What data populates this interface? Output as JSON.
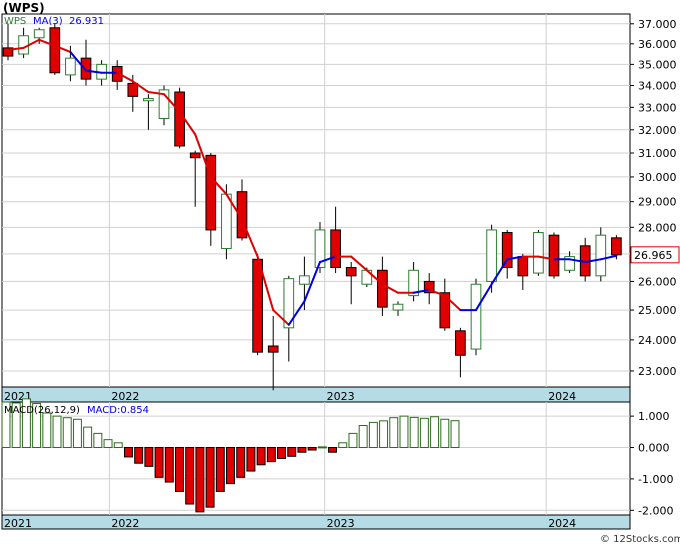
{
  "title": "(WPS)",
  "footer": "© 12Stocks.com",
  "colors": {
    "up": "#2e7d32",
    "down": "#e00000",
    "ma_down": "#e00000",
    "ma_up": "#0000e0",
    "macd_pos": "#2e6b1e",
    "macd_neg": "#e00000",
    "axis_band": "#b5dce6",
    "grid": "#d0d0d0",
    "last_box": "#e00000"
  },
  "chart_data": [
    {
      "type": "candlestick",
      "legend": {
        "symbol": "WPS",
        "ma_label": "MA(3)",
        "ma_value": "26.931"
      },
      "last_price_label": "26.965",
      "y_scale": "log",
      "ylim": [
        22.5,
        37.5
      ],
      "y_ticks": [
        "37.000",
        "36.000",
        "35.000",
        "34.000",
        "33.000",
        "32.000",
        "31.000",
        "30.000",
        "29.000",
        "28.000",
        "27.000",
        "26.000",
        "25.000",
        "24.000",
        "23.000"
      ],
      "x_labels": [
        "2021",
        "2022",
        "2023",
        "2024"
      ],
      "x_label_index": [
        0,
        6.5,
        20.3,
        34.5
      ],
      "grid": true,
      "candles": [
        {
          "o": 35.8,
          "h": 37.0,
          "l": 35.2,
          "c": 35.4
        },
        {
          "o": 35.5,
          "h": 36.8,
          "l": 35.3,
          "c": 36.4
        },
        {
          "o": 36.3,
          "h": 36.8,
          "l": 36.0,
          "c": 36.7
        },
        {
          "o": 36.8,
          "h": 37.0,
          "l": 34.5,
          "c": 34.6
        },
        {
          "o": 34.5,
          "h": 35.9,
          "l": 34.2,
          "c": 35.3
        },
        {
          "o": 35.3,
          "h": 36.2,
          "l": 34.0,
          "c": 34.3
        },
        {
          "o": 34.3,
          "h": 35.2,
          "l": 34.0,
          "c": 35.0
        },
        {
          "o": 34.9,
          "h": 35.2,
          "l": 33.8,
          "c": 34.2
        },
        {
          "o": 34.1,
          "h": 34.5,
          "l": 32.8,
          "c": 33.5
        },
        {
          "o": 33.3,
          "h": 33.6,
          "l": 32.0,
          "c": 33.4
        },
        {
          "o": 32.5,
          "h": 34.0,
          "l": 32.2,
          "c": 33.8
        },
        {
          "o": 33.7,
          "h": 33.9,
          "l": 31.2,
          "c": 31.3
        },
        {
          "o": 31.0,
          "h": 31.1,
          "l": 28.8,
          "c": 30.8
        },
        {
          "o": 30.9,
          "h": 31.0,
          "l": 27.3,
          "c": 27.9
        },
        {
          "o": 27.2,
          "h": 29.7,
          "l": 26.8,
          "c": 29.3
        },
        {
          "o": 29.4,
          "h": 29.9,
          "l": 27.5,
          "c": 27.6
        },
        {
          "o": 26.8,
          "h": 27.0,
          "l": 23.5,
          "c": 23.6
        },
        {
          "o": 23.8,
          "h": 24.8,
          "l": 22.4,
          "c": 23.6
        },
        {
          "o": 24.4,
          "h": 26.2,
          "l": 23.3,
          "c": 26.1
        },
        {
          "o": 25.9,
          "h": 26.9,
          "l": 25.0,
          "c": 26.2
        },
        {
          "o": 26.5,
          "h": 28.2,
          "l": 26.3,
          "c": 27.9
        },
        {
          "o": 27.9,
          "h": 28.8,
          "l": 26.3,
          "c": 26.5
        },
        {
          "o": 26.5,
          "h": 26.7,
          "l": 25.2,
          "c": 26.2
        },
        {
          "o": 25.9,
          "h": 26.5,
          "l": 25.8,
          "c": 26.4
        },
        {
          "o": 26.4,
          "h": 26.9,
          "l": 24.8,
          "c": 25.1
        },
        {
          "o": 25.0,
          "h": 25.3,
          "l": 24.8,
          "c": 25.2
        },
        {
          "o": 25.5,
          "h": 26.7,
          "l": 25.3,
          "c": 26.4
        },
        {
          "o": 26.0,
          "h": 26.3,
          "l": 25.2,
          "c": 25.6
        },
        {
          "o": 25.6,
          "h": 26.1,
          "l": 24.3,
          "c": 24.4
        },
        {
          "o": 24.3,
          "h": 24.4,
          "l": 22.8,
          "c": 23.5
        },
        {
          "o": 23.7,
          "h": 26.1,
          "l": 23.5,
          "c": 25.9
        },
        {
          "o": 26.0,
          "h": 28.1,
          "l": 25.6,
          "c": 27.9
        },
        {
          "o": 27.8,
          "h": 27.9,
          "l": 26.1,
          "c": 26.5
        },
        {
          "o": 26.9,
          "h": 27.0,
          "l": 25.7,
          "c": 26.2
        },
        {
          "o": 26.3,
          "h": 27.9,
          "l": 26.2,
          "c": 27.8
        },
        {
          "o": 27.7,
          "h": 27.8,
          "l": 26.1,
          "c": 26.2
        },
        {
          "o": 26.4,
          "h": 27.1,
          "l": 26.3,
          "c": 26.9
        },
        {
          "o": 27.3,
          "h": 27.6,
          "l": 26.0,
          "c": 26.2
        },
        {
          "o": 26.2,
          "h": 28.0,
          "l": 26.0,
          "c": 27.7
        },
        {
          "o": 27.6,
          "h": 27.7,
          "l": 26.8,
          "c": 26.965
        }
      ],
      "ma": [
        35.7,
        35.8,
        36.2,
        35.9,
        35.6,
        34.7,
        34.6,
        34.6,
        34.2,
        33.7,
        33.6,
        32.8,
        31.8,
        30.0,
        29.3,
        28.3,
        26.9,
        25.0,
        24.5,
        25.3,
        26.7,
        26.9,
        26.9,
        26.4,
        25.9,
        25.6,
        25.6,
        25.7,
        25.5,
        25.0,
        25.0,
        25.9,
        26.8,
        26.9,
        26.9,
        26.8,
        26.8,
        26.7,
        26.8,
        26.931
      ],
      "ma_color_switch": [
        [
          0,
          "ma_down"
        ],
        [
          4,
          "ma_up"
        ],
        [
          7,
          "ma_down"
        ],
        [
          18,
          "ma_up"
        ],
        [
          21,
          "ma_down"
        ],
        [
          26,
          "ma_up"
        ],
        [
          27,
          "ma_down"
        ],
        [
          29,
          "ma_up"
        ],
        [
          33,
          "ma_down"
        ],
        [
          35,
          "ma_up"
        ]
      ]
    },
    {
      "type": "bar",
      "legend": {
        "label": "MACD(26,12,9)",
        "value_label": "MACD:0.854"
      },
      "ylim": [
        -2.15,
        1.45
      ],
      "y_ticks": [
        "1.000",
        "0.000",
        "-1.000",
        "-2.000"
      ],
      "x_labels": [
        "2021",
        "2022",
        "2023",
        "2024"
      ],
      "values": [
        1.45,
        1.42,
        1.55,
        1.4,
        1.1,
        1.0,
        0.95,
        0.9,
        0.65,
        0.45,
        0.25,
        0.15,
        -0.3,
        -0.5,
        -0.6,
        -0.95,
        -1.1,
        -1.4,
        -1.8,
        -2.05,
        -1.9,
        -1.4,
        -1.15,
        -0.95,
        -0.75,
        -0.55,
        -0.45,
        -0.35,
        -0.28,
        -0.15,
        -0.08,
        0.02,
        -0.15,
        0.15,
        0.45,
        0.7,
        0.8,
        0.85,
        0.95,
        1.0,
        0.96,
        0.93,
        0.98,
        0.9,
        0.854
      ]
    }
  ]
}
